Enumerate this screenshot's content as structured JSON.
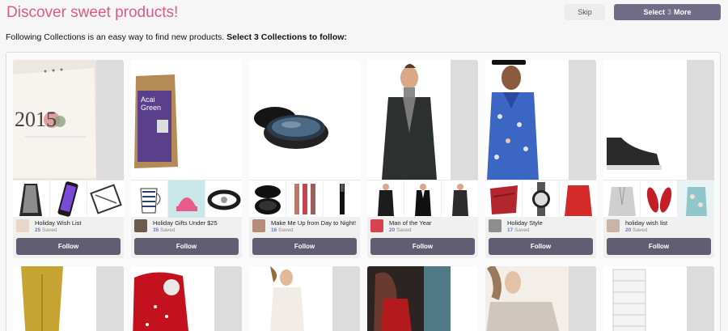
{
  "header": {
    "title": "Discover sweet products!",
    "skip_label": "Skip",
    "more_prefix": "Select",
    "more_count": "3",
    "more_suffix": "More"
  },
  "instructions": {
    "text": "Following Collections is an easy way to find new products. ",
    "bold": "Select 3 Collections to follow:"
  },
  "collections": [
    {
      "name": "Holiday Wish List",
      "saved_count": "25",
      "saved_label": "Saved",
      "follow_label": "Follow"
    },
    {
      "name": "Holiday Gifts Under $25",
      "saved_count": "35",
      "saved_label": "Saved",
      "follow_label": "Follow"
    },
    {
      "name": "Make Me Up from Day to Night!",
      "saved_count": "16",
      "saved_label": "Saved",
      "follow_label": "Follow"
    },
    {
      "name": "Man of the Year",
      "saved_count": "20",
      "saved_label": "Saved",
      "follow_label": "Follow"
    },
    {
      "name": "Holiday Style",
      "saved_count": "17",
      "saved_label": "Saved",
      "follow_label": "Follow"
    },
    {
      "name": "holiday wish list",
      "saved_count": "20",
      "saved_label": "Saved",
      "follow_label": "Follow"
    }
  ],
  "images": {
    "calendar_text": "2015",
    "tea_label_1": "Acai",
    "tea_label_2": "Green"
  },
  "colors": {
    "title": "#e0588a",
    "more_button": "#6f6d87",
    "follow_button": "#605e73",
    "saved_count": "#5b7bd5"
  }
}
